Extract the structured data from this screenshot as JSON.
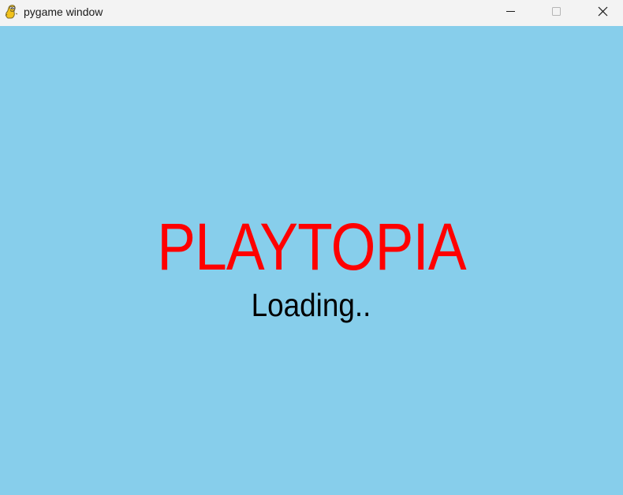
{
  "window": {
    "title": "pygame window",
    "icon": "pygame-snake-icon",
    "controls": {
      "minimize_icon": "minimize-icon",
      "maximize_icon": "maximize-icon",
      "close_icon": "close-icon"
    }
  },
  "game": {
    "background_color": "#87ceeb",
    "title": "PLAYTOPIA",
    "title_color": "#ff0000",
    "status": "Loading..",
    "status_color": "#000000"
  }
}
